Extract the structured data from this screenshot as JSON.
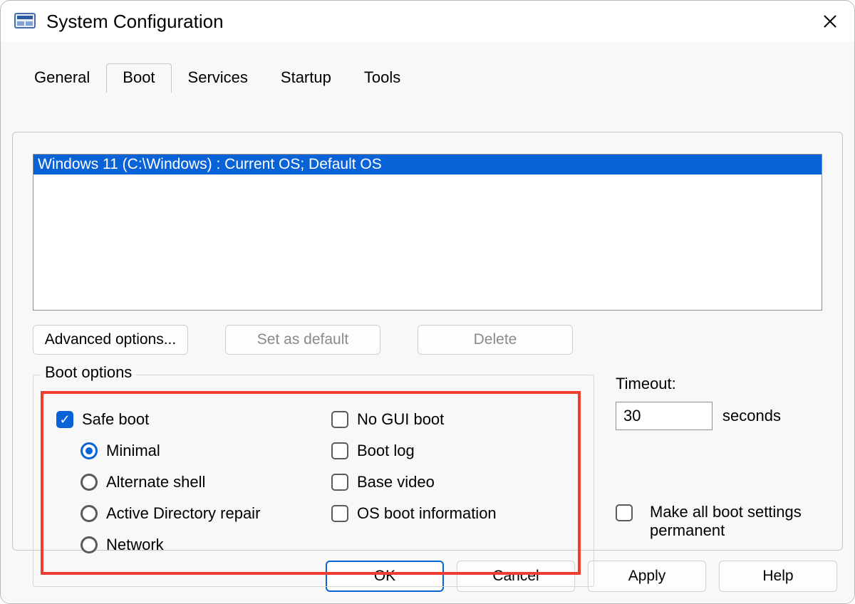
{
  "window": {
    "title": "System Configuration",
    "close_icon": "close-icon"
  },
  "tabs": [
    {
      "label": "General",
      "active": false
    },
    {
      "label": "Boot",
      "active": true
    },
    {
      "label": "Services",
      "active": false
    },
    {
      "label": "Startup",
      "active": false
    },
    {
      "label": "Tools",
      "active": false
    }
  ],
  "boot": {
    "os_entries": [
      "Windows 11 (C:\\Windows) : Current OS; Default OS"
    ],
    "buttons": {
      "advanced": "Advanced options...",
      "set_default": "Set as default",
      "delete": "Delete"
    },
    "fieldset_label": "Boot options",
    "safe_boot": {
      "label": "Safe boot",
      "checked": true,
      "modes": [
        {
          "label": "Minimal",
          "selected": true
        },
        {
          "label": "Alternate shell",
          "selected": false
        },
        {
          "label": "Active Directory repair",
          "selected": false
        },
        {
          "label": "Network",
          "selected": false
        }
      ]
    },
    "right_checks": [
      {
        "label": "No GUI boot",
        "checked": false
      },
      {
        "label": "Boot log",
        "checked": false
      },
      {
        "label": "Base video",
        "checked": false
      },
      {
        "label": "OS boot information",
        "checked": false
      }
    ],
    "timeout": {
      "label": "Timeout:",
      "value": "30",
      "unit": "seconds"
    },
    "permanent": {
      "label": "Make all boot settings permanent",
      "checked": false
    }
  },
  "dialog_buttons": {
    "ok": "OK",
    "cancel": "Cancel",
    "apply": "Apply",
    "help": "Help"
  }
}
